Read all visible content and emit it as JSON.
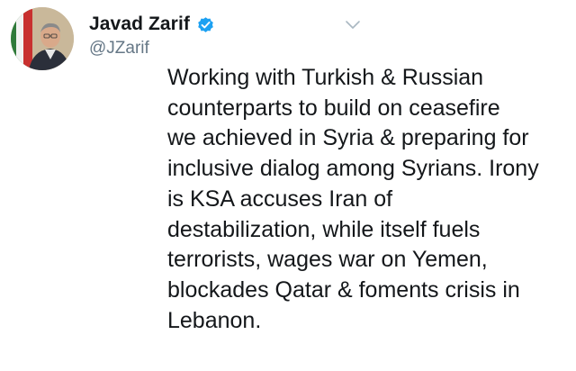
{
  "author": {
    "name": "Javad Zarif",
    "handle": "@JZarif",
    "verified": true,
    "verified_color": "#1da1f2"
  },
  "icons": {
    "verified": "verified-badge-icon",
    "menu": "chevron-down-icon",
    "avatar": "profile-photo"
  },
  "tweet": {
    "text_lines": [
      "Working with Turkish & Russian",
      "counterparts to build on ceasefire",
      "we achieved in Syria & preparing for",
      "inclusive dialog among Syrians. Irony",
      "is KSA accuses Iran of",
      "destabilization, while itself fuels",
      "terrorists, wages war on Yemen,",
      "blockades Qatar & foments crisis in",
      "Lebanon."
    ]
  }
}
